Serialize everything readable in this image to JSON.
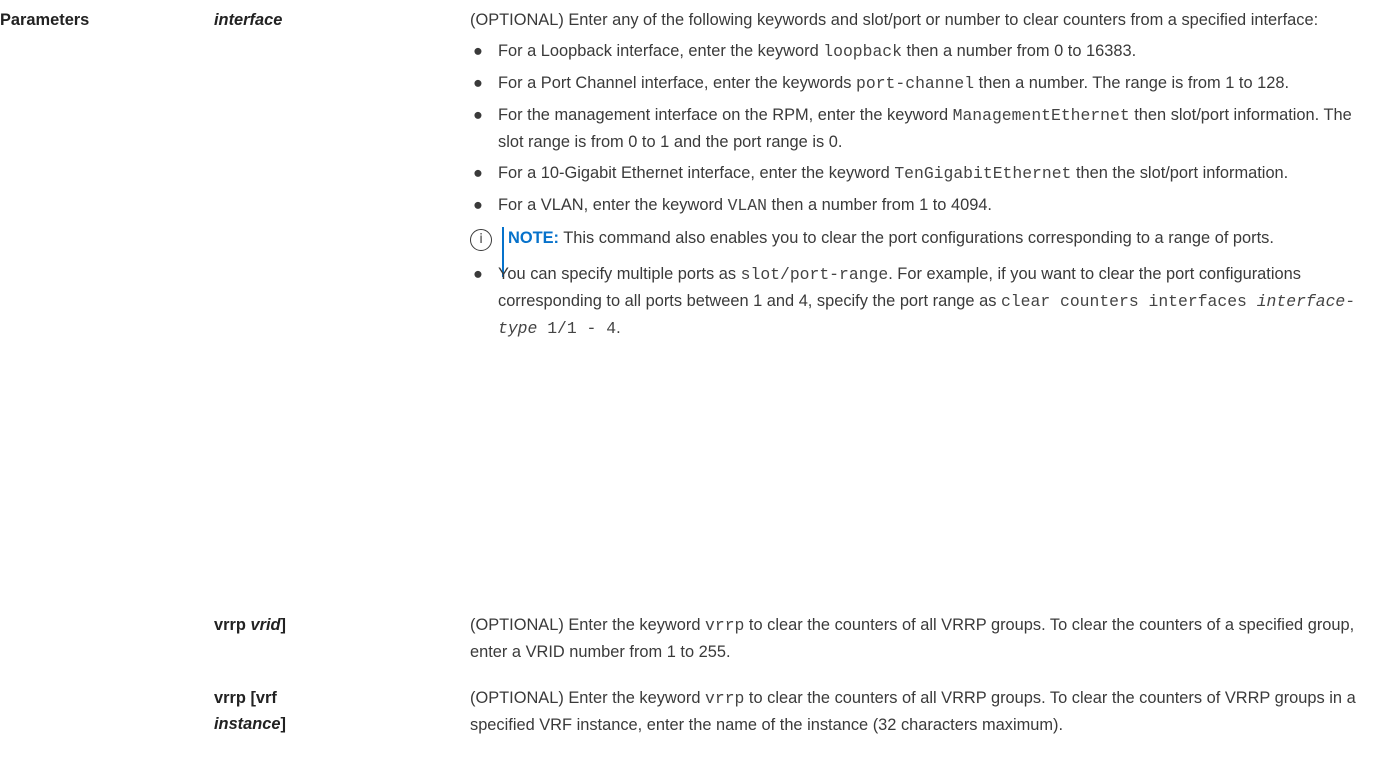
{
  "section_label": "Parameters",
  "params": [
    {
      "term_plain": "",
      "term_italic": "interface",
      "term_suffix": "",
      "intro": "(OPTIONAL) Enter any of the following keywords and slot/port or number to clear counters from a specified interface:",
      "items": [
        {
          "pre": "For a Loopback interface, enter the keyword ",
          "code": "loopback",
          "post": " then a number from 0 to 16383."
        },
        {
          "pre": "For a Port Channel interface, enter the keywords ",
          "code": "port-channel",
          "post": " then a number. The range is from 1 to 128."
        },
        {
          "pre": "For the management interface on the RPM, enter the keyword ",
          "code": "ManagementEthernet",
          "post": " then slot/port information. The slot range is from 0 to 1 and the port range is 0."
        },
        {
          "pre": "For a 10-Gigabit Ethernet interface, enter the keyword ",
          "code": "TenGigabitEthernet",
          "post": " then the slot/port information."
        },
        {
          "pre": "For a VLAN, enter the keyword ",
          "code": "VLAN",
          "post": " then a number from 1 to 4094."
        }
      ],
      "note": {
        "label": "NOTE:",
        "text": " This command also enables you to clear the port configurations corresponding to a range of ports."
      },
      "last_item": {
        "pre": "You can specify multiple ports as ",
        "code1": "slot/port-range",
        "mid": ". For example, if you want to clear the port configurations corresponding to all ports between 1 and 4, specify the port range as ",
        "code2": "clear counters interfaces ",
        "code2_italic": "interface-type",
        "code3": " 1/1 - 4",
        "post": "."
      }
    },
    {
      "term_plain": "vrrp ",
      "term_italic": "vrid",
      "term_suffix": "]",
      "desc_pre": "(OPTIONAL) Enter the keyword ",
      "desc_code": "vrrp",
      "desc_post": " to clear the counters of all VRRP groups. To clear the counters of a specified group, enter a VRID number from 1 to 255."
    },
    {
      "term_plain": "vrrp [vrf",
      "term_italic": "instance",
      "term_suffix": "]",
      "desc_pre": "(OPTIONAL) Enter the keyword ",
      "desc_code": "vrrp",
      "desc_post": " to clear the counters of all VRRP groups. To clear the counters of VRRP groups in a specified VRF instance, enter the name of the instance (32 characters maximum)."
    }
  ],
  "icons": {
    "note": "info-circle-icon",
    "bullet": "bullet-dot-icon"
  },
  "colors": {
    "note_accent": "#0672cb",
    "text": "#3a3a3a",
    "heading": "#222222"
  }
}
